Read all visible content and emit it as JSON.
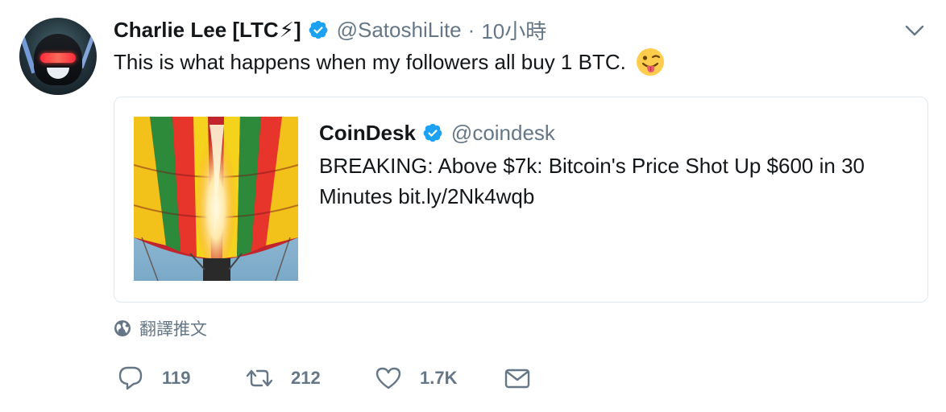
{
  "tweet": {
    "author_name": "Charlie Lee [LTC",
    "author_name_suffix": "]",
    "name_emoji": "⚡",
    "handle": "@SatoshiLite",
    "separator": "·",
    "time": "10小時",
    "text": "This is what happens when my followers all buy 1 BTC."
  },
  "quoted": {
    "name": "CoinDesk",
    "handle": "@coindesk",
    "text": "BREAKING: Above $7k: Bitcoin's Price Shot Up $600 in 30 Minutes bit.ly/2Nk4wqb"
  },
  "translate": {
    "label": "翻譯推文",
    "icon": "globe-icon"
  },
  "actions": {
    "reply_count": "119",
    "retweet_count": "212",
    "like_count": "1.7K"
  },
  "colors": {
    "verified_blue": "#1da1f2",
    "muted_gray": "#657786",
    "text_dark": "#14171a",
    "border": "#e1e8ed"
  }
}
